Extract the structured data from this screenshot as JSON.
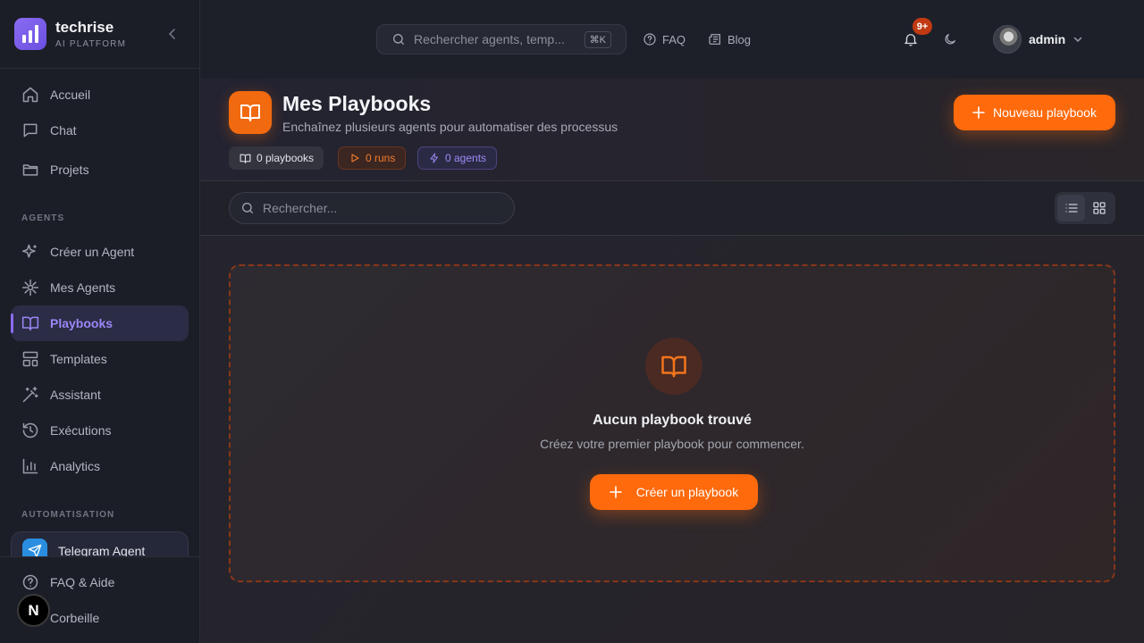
{
  "brand": {
    "name": "techrise",
    "subtitle": "AI PLATFORM"
  },
  "sidebar": {
    "main_items": [
      {
        "label": "Accueil",
        "icon": "home-icon"
      },
      {
        "label": "Chat",
        "icon": "chat-icon"
      },
      {
        "label": "Projets",
        "icon": "folder-icon"
      }
    ],
    "agents_section_label": "AGENTS",
    "agent_items": [
      {
        "label": "Créer un Agent",
        "icon": "sparkles-icon"
      },
      {
        "label": "Mes Agents",
        "icon": "asterisk-icon"
      },
      {
        "label": "Playbooks",
        "icon": "book-icon",
        "active": true
      },
      {
        "label": "Templates",
        "icon": "layout-icon"
      },
      {
        "label": "Assistant",
        "icon": "wand-icon"
      },
      {
        "label": "Exécutions",
        "icon": "history-icon"
      },
      {
        "label": "Analytics",
        "icon": "chart-icon"
      }
    ],
    "automation_section_label": "AUTOMATISATION",
    "telegram_label": "Telegram Agent",
    "footer_items": [
      {
        "label": "FAQ & Aide",
        "icon": "help-icon"
      },
      {
        "label": "Corbeille",
        "icon": "trash-icon"
      }
    ],
    "dev_badge": "N"
  },
  "header": {
    "search_placeholder": "Rechercher agents, temp...",
    "search_shortcut": "⌘K",
    "links": [
      {
        "label": "FAQ",
        "icon": "help-circle-icon"
      },
      {
        "label": "Blog",
        "icon": "newspaper-icon"
      }
    ],
    "notifications_badge": "9+",
    "user_name": "admin"
  },
  "page": {
    "title": "Mes Playbooks",
    "subtitle": "Enchaînez plusieurs agents pour automatiser des processus",
    "stats": {
      "playbooks": "0 playbooks",
      "runs": "0 runs",
      "agents": "0 agents"
    },
    "new_button": "Nouveau playbook",
    "search_placeholder": "Rechercher...",
    "empty_state": {
      "title": "Aucun playbook trouvé",
      "subtitle": "Créez votre premier playbook pour commencer.",
      "button": "Créer un playbook"
    }
  },
  "colors": {
    "accent": "#ff6a0d",
    "violet": "#8b6cf2",
    "background": "#1e2029"
  }
}
